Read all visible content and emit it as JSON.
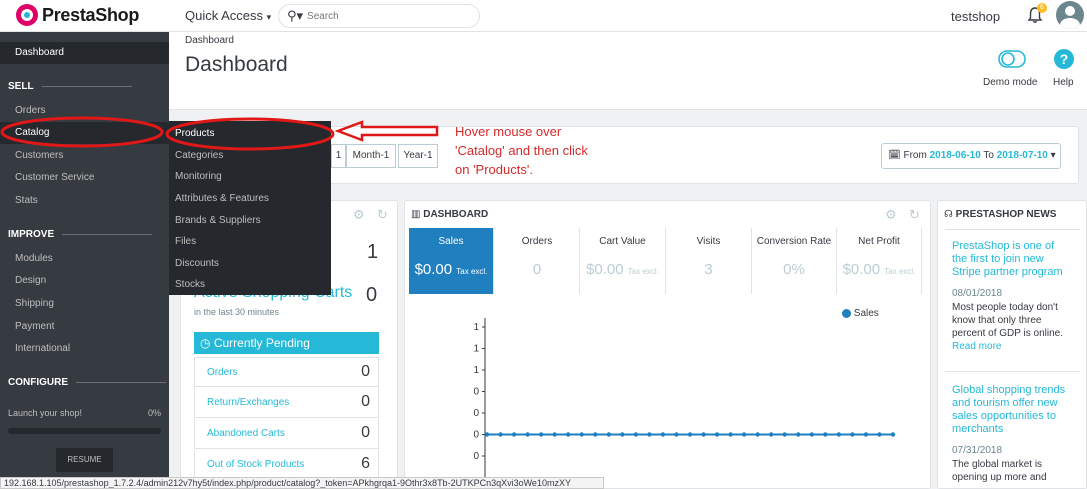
{
  "brand": {
    "name": "PrestaShop"
  },
  "topbar": {
    "quick_access": "Quick Access",
    "search_placeholder": "Search",
    "shop_name": "testshop",
    "notification_count": "6"
  },
  "sidebar": {
    "dashboard": "Dashboard",
    "sections": [
      {
        "title": "SELL",
        "items": [
          "Orders",
          "Catalog",
          "Customers",
          "Customer Service",
          "Stats"
        ]
      },
      {
        "title": "IMPROVE",
        "items": [
          "Modules",
          "Design",
          "Shipping",
          "Payment",
          "International"
        ]
      },
      {
        "title": "CONFIGURE",
        "items": []
      }
    ],
    "launch_label": "Launch your shop!",
    "launch_percent": "0%",
    "launch_progress": 0,
    "resume_label": "RESUME"
  },
  "submenu": {
    "items": [
      "Products",
      "Categories",
      "Monitoring",
      "Attributes & Features",
      "Brands & Suppliers",
      "Files",
      "Discounts",
      "Stocks"
    ]
  },
  "header": {
    "breadcrumb": "Dashboard",
    "title": "Dashboard",
    "demo_mode": "Demo mode",
    "help": "Help"
  },
  "toolbar": {
    "periods": [
      "Month-1",
      "Year-1"
    ],
    "date_from_label": "From",
    "date_from": "2018-06-10",
    "date_to_label": "To",
    "date_to": "2018-07-10"
  },
  "activity": {
    "online_visitors": "1",
    "active_carts_label": "Active Shopping Carts",
    "active_carts_value": "0",
    "active_carts_sub": "in the last 30 minutes",
    "pending_title": "Currently Pending",
    "pending": [
      {
        "label": "Orders",
        "value": "0"
      },
      {
        "label": "Return/Exchanges",
        "value": "0"
      },
      {
        "label": "Abandoned Carts",
        "value": "0"
      },
      {
        "label": "Out of Stock Products",
        "value": "6"
      }
    ]
  },
  "dashboard": {
    "title": "DASHBOARD",
    "kpis": [
      {
        "name": "Sales",
        "value": "$0.00",
        "suffix": "Tax excl."
      },
      {
        "name": "Orders",
        "value": "0",
        "suffix": ""
      },
      {
        "name": "Cart Value",
        "value": "$0.00",
        "suffix": "Tax excl."
      },
      {
        "name": "Visits",
        "value": "3",
        "suffix": ""
      },
      {
        "name": "Conversion Rate",
        "value": "0%",
        "suffix": ""
      },
      {
        "name": "Net Profit",
        "value": "$0.00",
        "suffix": "Tax excl."
      }
    ],
    "legend": "Sales",
    "y_ticks": [
      "1",
      "1",
      "1",
      "0",
      "0",
      "0",
      "0"
    ],
    "series_color": "#1f7fbf",
    "point_count": 31
  },
  "news": {
    "title": "PRESTASHOP NEWS",
    "items": [
      {
        "title": "PrestaShop is one of the first to join new Stripe partner program",
        "date": "08/01/2018",
        "text": "Most people today don't know that only three percent of GDP is online.",
        "link": "Read more"
      },
      {
        "title": "Global shopping trends and tourism offer new sales opportunities to merchants",
        "date": "07/31/2018",
        "text": "The global market is opening up more and"
      }
    ]
  },
  "annotation": {
    "line1": "Hover mouse over",
    "line2": "'Catalog' and then click",
    "line3": "on 'Products'.",
    "color": "#d42a2a"
  },
  "status_url": "192.168.1.105/prestashop_1.7.2.4/admin212v7hy5t/index.php/product/catalog?_token=APkhgrqa1-9Othr3x8Tb-2UTKPCn3qXvi3oWe10mzXY"
}
